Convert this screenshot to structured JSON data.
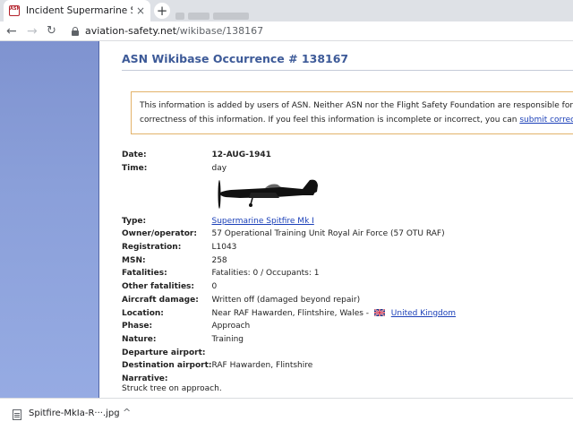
{
  "browser": {
    "tab_title": "Incident Supermarine Spitfire",
    "tab_close": "×",
    "new_tab": "+",
    "favicon_text": "ASN",
    "url_host": "aviation-safety.net",
    "url_path": "/wikibase/138167"
  },
  "page": {
    "title": "ASN Wikibase Occurrence # 138167",
    "notice": {
      "line1": "This information is added by users of ASN. Neither ASN nor the Flight Safety Foundation are responsible for the completeness or",
      "line2_prefix": "correctness of this information. If you feel this information is incomplete or incorrect, you can ",
      "link": "submit corrected information"
    },
    "details": {
      "date_label": "Date:",
      "date": "12-AUG-1941",
      "time_label": "Time:",
      "time": "day",
      "type_label": "Type:",
      "type": "Supermarine Spitfire Mk I",
      "operator_label": "Owner/operator:",
      "operator": "57 Operational Training Unit Royal Air Force (57 OTU RAF)",
      "registration_label": "Registration:",
      "registration": "L1043",
      "msn_label": "MSN:",
      "msn": "258",
      "fatalities_label": "Fatalities:",
      "fatalities": "Fatalities: 0 / Occupants: 1",
      "other_fatalities_label": "Other fatalities:",
      "other_fatalities": "0",
      "damage_label": "Aircraft damage:",
      "damage": "Written off (damaged beyond repair)",
      "location_label": "Location:",
      "location": "Near RAF Hawarden, Flintshire, Wales -",
      "country": "United Kingdom",
      "phase_label": "Phase:",
      "phase": "Approach",
      "nature_label": "Nature:",
      "nature": "Training",
      "departure_label": "Departure airport:",
      "departure": "",
      "destination_label": "Destination airport:",
      "destination": "RAF Hawarden, Flintshire",
      "narrative_label": "Narrative:",
      "narrative": "Struck tree on approach."
    }
  },
  "downloads": {
    "file_name": "Spitfire-MkIa-R···.jpg",
    "chevron": "^"
  },
  "colors": {
    "sidebar": "#8a9fd9",
    "title": "#3d5a98",
    "notice_border": "#e3b36a",
    "link": "#1a3fb8"
  }
}
